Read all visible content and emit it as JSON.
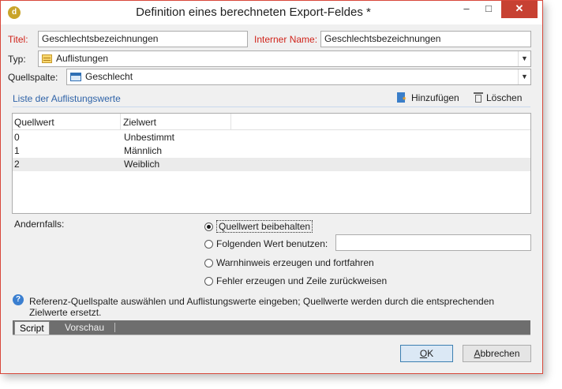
{
  "window": {
    "title": "Definition eines berechneten Export-Feldes *",
    "app_icon_glyph": "d",
    "controls": {
      "minimize": "–",
      "maximize": "□",
      "close": "✕"
    }
  },
  "form": {
    "titel_label": "Titel:",
    "titel_value": "Geschlechtsbezeichnungen",
    "interner_name_label": "Interner Name:",
    "interner_name_value": "Geschlechtsbezeichnungen",
    "typ_label": "Typ:",
    "typ_value": "Auflistungen",
    "typ_icon": "list-icon",
    "quellspalte_label": "Quellspalte:",
    "quellspalte_value": "Geschlecht",
    "quellspalte_icon": "column-icon"
  },
  "list": {
    "section_title": "Liste der Auflistungswerte",
    "add_label": "Hinzufügen",
    "delete_label": "Löschen",
    "columns": [
      "Quellwert",
      "Zielwert"
    ],
    "rows": [
      {
        "source": "0",
        "target": "Unbestimmt"
      },
      {
        "source": "1",
        "target": "Männlich"
      },
      {
        "source": "2",
        "target": "Weiblich"
      }
    ],
    "selected_row": 2
  },
  "otherwise": {
    "label": "Andernfalls:",
    "options": [
      "Quellwert beibehalten",
      "Folgenden Wert benutzen:",
      "Warnhinweis erzeugen und fortfahren",
      "Fehler erzeugen und Zeile zurückweisen"
    ],
    "selected": 0,
    "value_input": ""
  },
  "info": {
    "text": "Referenz-Quellspalte auswählen und Auflistungswerte eingeben; Quellwerte werden durch die entsprechenden Zielwerte ersetzt."
  },
  "tabs": {
    "script": "Script",
    "preview": "Vorschau",
    "active": "script"
  },
  "buttons": {
    "ok_accel": "O",
    "ok_rest": "K",
    "cancel_accel": "A",
    "cancel_rest": "bbrechen"
  },
  "colors": {
    "required_label": "#d0241b",
    "section_title": "#2f63a8",
    "close_button": "#c74132",
    "tab_bar": "#6e6e6e"
  }
}
